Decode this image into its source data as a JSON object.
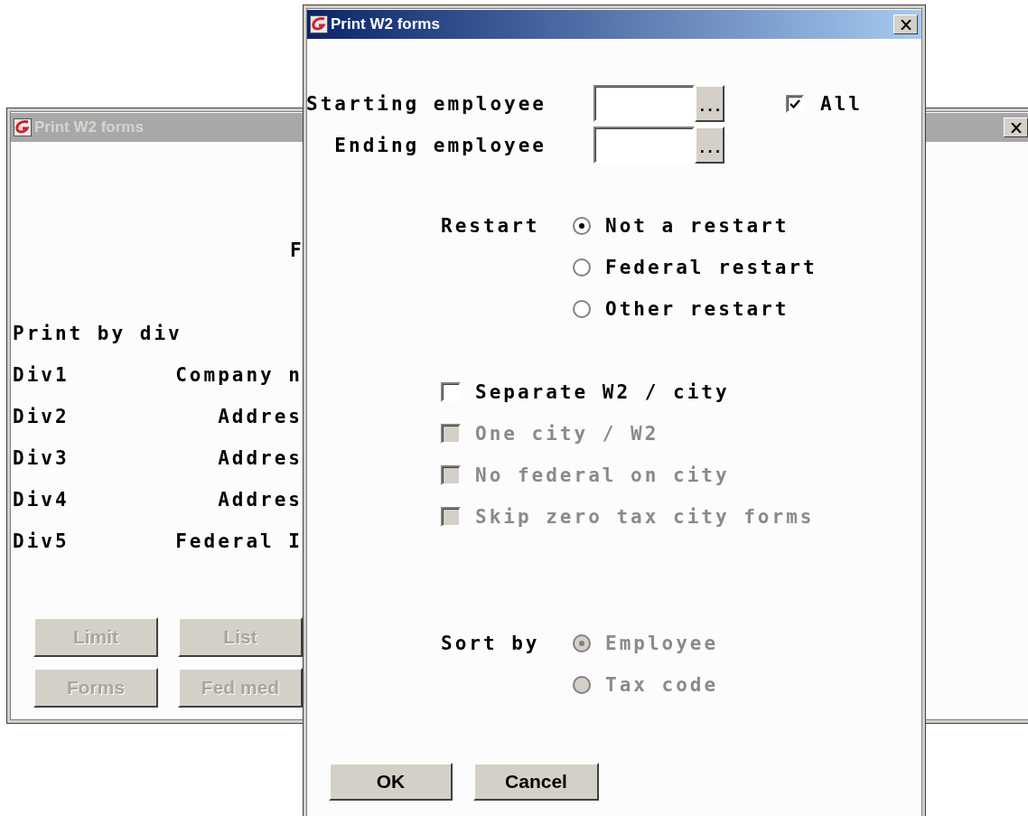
{
  "background_window": {
    "title": "Print W2 forms",
    "active": false,
    "heading": "F",
    "print_by_label": "Print by div",
    "divisions": [
      {
        "label": "Div1",
        "value": "Company n"
      },
      {
        "label": "Div2",
        "value": "Addres"
      },
      {
        "label": "Div3",
        "value": "Addres"
      },
      {
        "label": "Div4",
        "value": "Addres"
      },
      {
        "label": "Div5",
        "value": "Federal I"
      }
    ],
    "buttons": [
      {
        "label": "Limit",
        "disabled": true
      },
      {
        "label": "List",
        "disabled": true
      },
      {
        "label": "Forms",
        "disabled": true
      },
      {
        "label": "Fed med",
        "disabled": true
      }
    ]
  },
  "dialog": {
    "title": "Print W2 forms",
    "active": true,
    "employee_fields": [
      {
        "label": "Starting employee",
        "lookup": "..."
      },
      {
        "label": "Ending employee",
        "lookup": "..."
      }
    ],
    "all_checkbox": {
      "label": "All",
      "checked": true
    },
    "restart": {
      "label": "Restart",
      "options": [
        {
          "label": "Not a restart",
          "selected": true,
          "disabled": false
        },
        {
          "label": "Federal restart",
          "selected": false,
          "disabled": false
        },
        {
          "label": "Other restart",
          "selected": false,
          "disabled": false
        }
      ]
    },
    "city_options": [
      {
        "label": "Separate W2 / city",
        "checked": false,
        "disabled": false
      },
      {
        "label": "One city / W2",
        "checked": false,
        "disabled": true
      },
      {
        "label": "No federal on city",
        "checked": false,
        "disabled": true
      },
      {
        "label": "Skip zero tax city forms",
        "checked": false,
        "disabled": true
      }
    ],
    "sort_by": {
      "label": "Sort by",
      "options": [
        {
          "label": "Employee",
          "selected": true,
          "disabled": true
        },
        {
          "label": "Tax code",
          "selected": false,
          "disabled": true
        }
      ]
    },
    "buttons": [
      {
        "label": "OK"
      },
      {
        "label": "Cancel"
      }
    ]
  }
}
